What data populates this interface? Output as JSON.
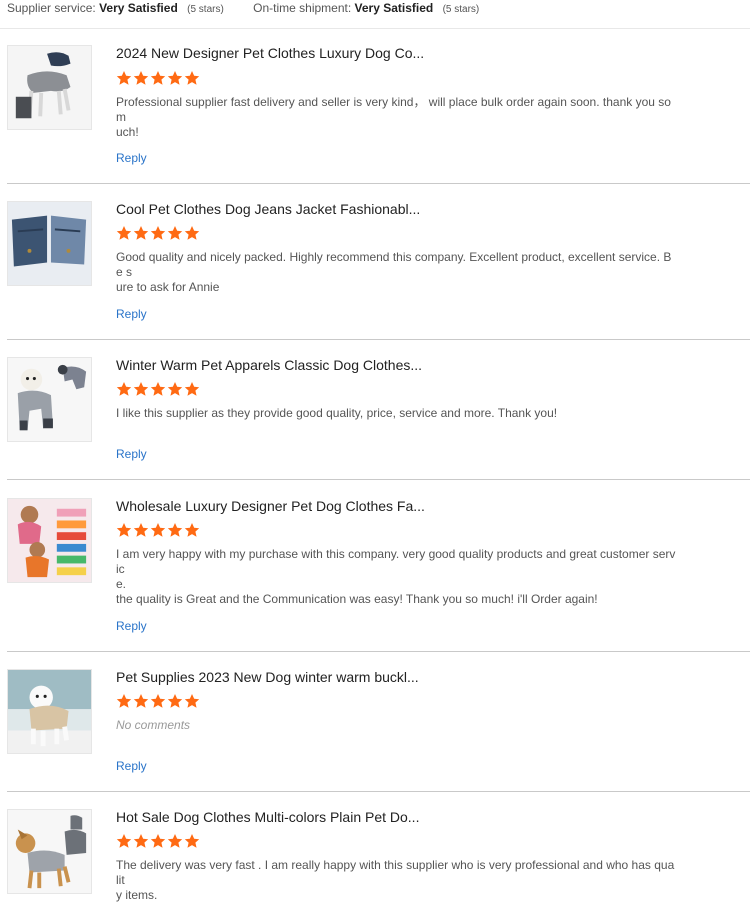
{
  "summary": {
    "supplier_label": "Supplier service:",
    "supplier_value": "Very Satisfied",
    "supplier_stars": "(5 stars)",
    "shipment_label": "On-time shipment:",
    "shipment_value": "Very Satisfied",
    "shipment_stars": "(5 stars)"
  },
  "star_color": "#ff6a13",
  "link_color": "#2a74c9",
  "reply_label": "Reply",
  "reviews": [
    {
      "title": "2024 New Designer Pet Clothes Luxury Dog Co...",
      "rating": 5,
      "comment_lines": [
        "Professional supplier fast delivery and seller is very kind， will place bulk order again soon. thank you so m",
        "uch!"
      ]
    },
    {
      "title": "Cool Pet Clothes Dog Jeans Jacket Fashionabl...",
      "rating": 5,
      "comment_lines": [
        "Good quality and nicely packed. Highly recommend this company. Excellent product, excellent service. Be s",
        "ure to ask for Annie"
      ]
    },
    {
      "title": "Winter Warm Pet Apparels Classic Dog Clothes...",
      "rating": 5,
      "comment_lines": [
        "I like this supplier as they provide good quality, price, service and more. Thank you!"
      ]
    },
    {
      "title": "Wholesale Luxury Designer Pet Dog Clothes Fa...",
      "rating": 5,
      "comment_lines": [
        "I am very happy with my purchase with this company. very good quality products and great customer servic",
        "e.",
        "the quality is Great and the Communication was easy! Thank you so much! i'll Order again!"
      ]
    },
    {
      "title": "Pet Supplies 2023 New Dog winter warm buckl...",
      "rating": 5,
      "comment_lines": [
        "No comments"
      ],
      "empty": true
    },
    {
      "title": "Hot Sale Dog Clothes Multi-colors Plain Pet Do...",
      "rating": 5,
      "comment_lines": [
        "The delivery was very fast . I am really happy with this supplier who is very professional and who has qualit",
        "y items."
      ]
    }
  ]
}
